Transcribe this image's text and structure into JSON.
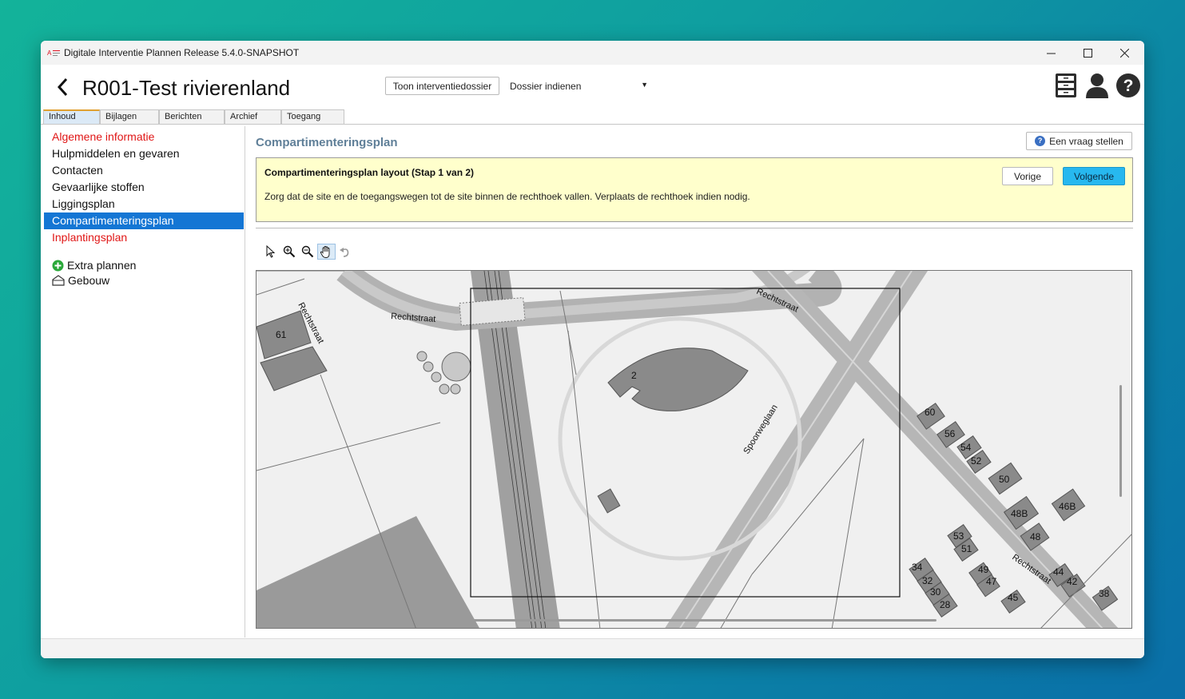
{
  "window": {
    "title": "Digitale Interventie Plannen Release 5.4.0-SNAPSHOT"
  },
  "header": {
    "title": "R001-Test rivierenland",
    "show_dossier_label": "Toon interventiedossier",
    "submit_select_value": "Dossier indienen"
  },
  "tabs": [
    "Inhoud",
    "Bijlagen",
    "Berichten",
    "Archief",
    "Toegang"
  ],
  "sidebar": {
    "items": [
      {
        "label": "Algemene informatie"
      },
      {
        "label": "Hulpmiddelen en gevaren"
      },
      {
        "label": "Contacten"
      },
      {
        "label": "Gevaarlijke stoffen"
      },
      {
        "label": "Liggingsplan"
      },
      {
        "label": "Compartimenteringsplan"
      },
      {
        "label": "Inplantingsplan"
      }
    ],
    "extra_plans": "Extra plannen",
    "building": "Gebouw"
  },
  "main": {
    "section_title": "Compartimenteringsplan",
    "ask_button": "Een vraag stellen",
    "wizard": {
      "title": "Compartimenteringsplan layout (Stap 1 van 2)",
      "text": "Zorg dat de site en de toegangswegen tot de site binnen de rechthoek vallen. Verplaats de rechthoek indien nodig.",
      "prev": "Vorige",
      "next": "Volgende"
    }
  },
  "map": {
    "streets": [
      "Rechtstraat",
      "Rechtstraat",
      "Rechtstraat",
      "Rechtstraat",
      "Spoorweglaan"
    ],
    "building_numbers": [
      "61",
      "2",
      "60",
      "56",
      "54",
      "52",
      "50",
      "48B",
      "46B",
      "48",
      "53",
      "51",
      "34",
      "32",
      "30",
      "28",
      "49",
      "47",
      "45",
      "44",
      "42",
      "38"
    ]
  },
  "colors": {
    "selected": "#1476d4",
    "primary_button": "#27b8ef",
    "warning_bg": "#ffffcc",
    "required": "#e01616"
  }
}
